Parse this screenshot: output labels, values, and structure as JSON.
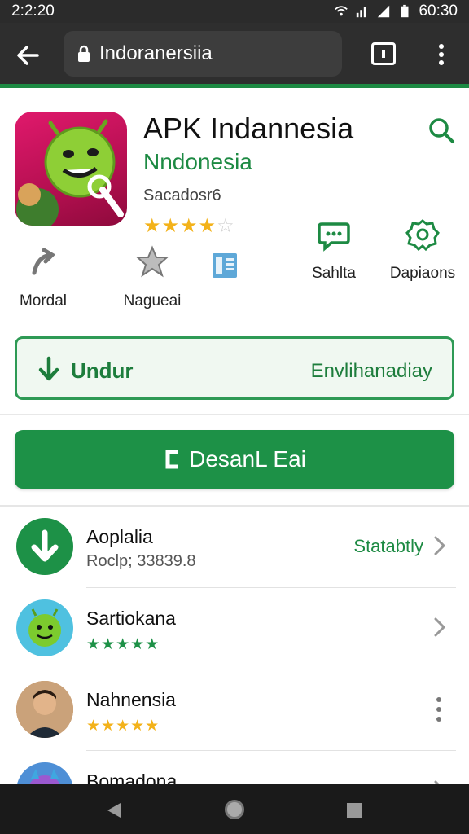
{
  "status_bar": {
    "time": "2:2:20",
    "clock_right": "60:30"
  },
  "browser": {
    "url": "Indoranersiia"
  },
  "app": {
    "title": "APK Indannesia",
    "subtitle": "Nndonesia",
    "developer": "Sacadosr6",
    "rating_stars": 4,
    "rating_max": 5,
    "install_label": "Undur",
    "install_right_label": "Envlihanadiay"
  },
  "actions": [
    {
      "label": "Mordal",
      "icon": "curve-arrow-icon"
    },
    {
      "label": "Nagueai",
      "icon": "gear-star-icon"
    },
    {
      "label": "",
      "icon": "book-icon"
    },
    {
      "label": "Sahlta",
      "icon": "chat-bubble-icon"
    },
    {
      "label": "Dapiaons",
      "icon": "settings-gear-icon"
    }
  ],
  "primary_button": {
    "label": "DesanL Eai"
  },
  "list": [
    {
      "name": "Aoplalia",
      "meta": "Roclp; 33839.8",
      "status": "Statabtly",
      "trailing": "chevron"
    },
    {
      "name": "Sartiokana",
      "meta": "★★★★★",
      "trailing": "chevron"
    },
    {
      "name": "Nahnensia",
      "meta": "★★★★★",
      "trailing": "more"
    },
    {
      "name": "Bomadona",
      "trailing": "chevron"
    }
  ],
  "colors": {
    "accent": "#1d9147",
    "accent_text": "#1d8a43",
    "star": "#f3b21a"
  }
}
